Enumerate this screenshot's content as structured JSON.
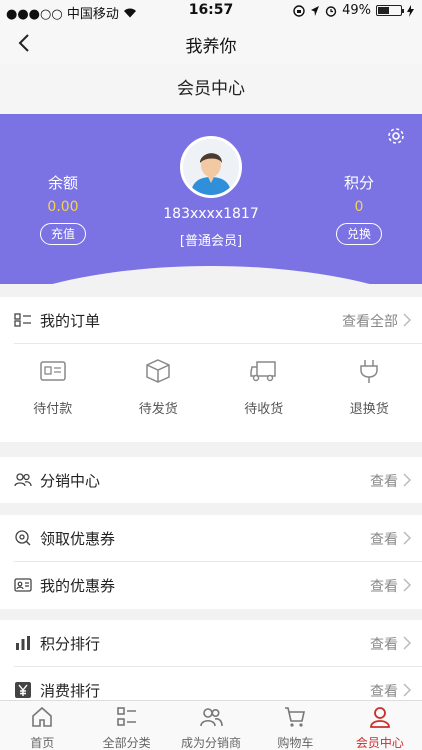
{
  "status_bar": {
    "carrier": "●●●○○ 中国移动",
    "time": "16:57",
    "battery": "49%"
  },
  "nav": {
    "title": "我养你"
  },
  "page": {
    "title": "会员中心"
  },
  "profile": {
    "phone": "183xxxx1817",
    "level": "[普通会员]",
    "balance_label": "余额",
    "balance_value": "0.00",
    "recharge_label": "充值",
    "points_label": "积分",
    "points_value": "0",
    "exchange_label": "兑换"
  },
  "orders": {
    "title": "我的订单",
    "view_all": "查看全部",
    "items": [
      {
        "label": "待付款",
        "icon": "card-icon"
      },
      {
        "label": "待发货",
        "icon": "box-icon"
      },
      {
        "label": "待收货",
        "icon": "truck-icon"
      },
      {
        "label": "退换货",
        "icon": "plug-icon"
      }
    ]
  },
  "menu": [
    {
      "label": "分销中心",
      "action": "查看",
      "icon": "people-icon"
    },
    {
      "label": "领取优惠券",
      "action": "查看",
      "icon": "coupon-search-icon"
    },
    {
      "label": "我的优惠券",
      "action": "查看",
      "icon": "id-card-icon"
    },
    {
      "label": "积分排行",
      "action": "查看",
      "icon": "bar-chart-icon"
    },
    {
      "label": "消费排行",
      "action": "查看",
      "icon": "yen-icon"
    }
  ],
  "tabbar": [
    {
      "label": "首页",
      "icon": "home-icon",
      "active": false
    },
    {
      "label": "全部分类",
      "icon": "category-icon",
      "active": false
    },
    {
      "label": "成为分销商",
      "icon": "group-icon",
      "active": false
    },
    {
      "label": "购物车",
      "icon": "cart-icon",
      "active": false
    },
    {
      "label": "会员中心",
      "icon": "user-icon",
      "active": true
    }
  ],
  "colors": {
    "hero": "#7b73e3",
    "accent": "#cc2d2d",
    "value": "#f5d34a"
  }
}
